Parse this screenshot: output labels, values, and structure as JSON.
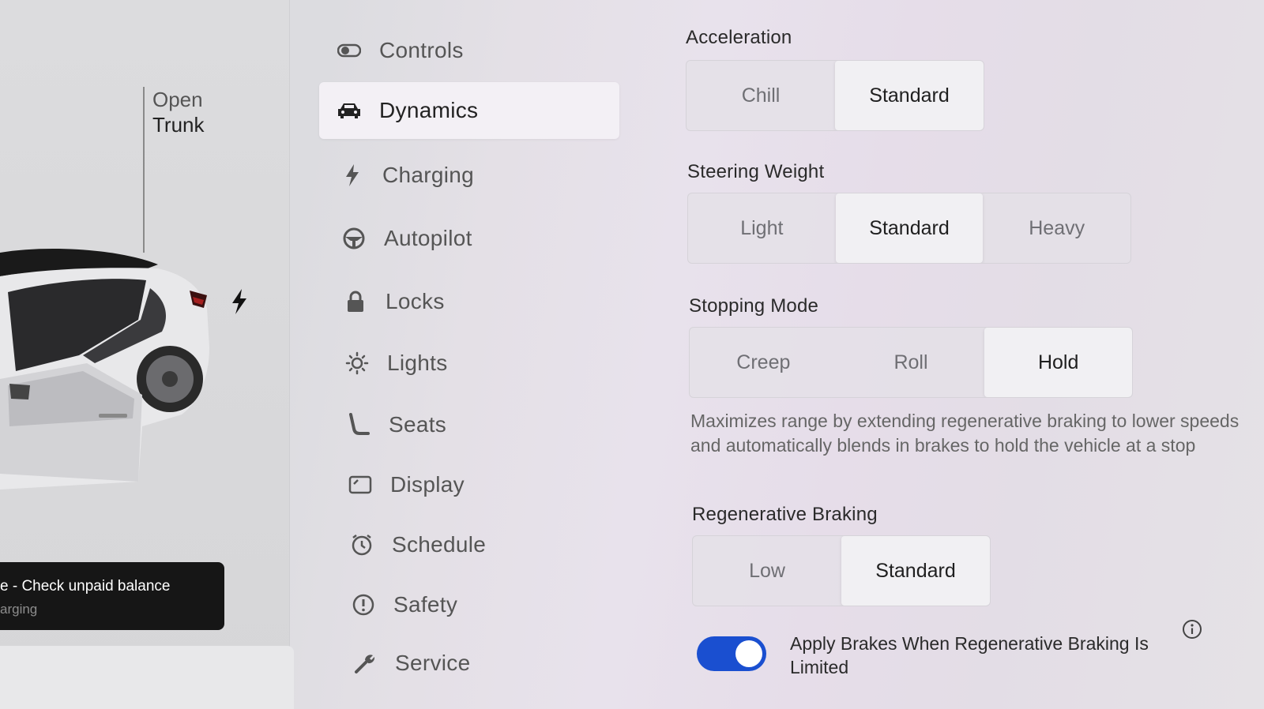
{
  "car_panel": {
    "trunk_line1": "Open",
    "trunk_line2": "Trunk",
    "toast_title": "e - Check unpaid balance",
    "toast_subtitle": "arging"
  },
  "nav": {
    "items": [
      {
        "label": "Controls",
        "icon": "toggle-icon"
      },
      {
        "label": "Dynamics",
        "icon": "car-icon",
        "active": true
      },
      {
        "label": "Charging",
        "icon": "bolt-icon"
      },
      {
        "label": "Autopilot",
        "icon": "steering-wheel-icon"
      },
      {
        "label": "Locks",
        "icon": "lock-icon"
      },
      {
        "label": "Lights",
        "icon": "sun-icon"
      },
      {
        "label": "Seats",
        "icon": "seat-icon"
      },
      {
        "label": "Display",
        "icon": "display-icon"
      },
      {
        "label": "Schedule",
        "icon": "alarm-clock-icon"
      },
      {
        "label": "Safety",
        "icon": "alert-circle-icon"
      },
      {
        "label": "Service",
        "icon": "wrench-icon"
      }
    ]
  },
  "dynamics": {
    "acceleration": {
      "title": "Acceleration",
      "options": [
        "Chill",
        "Standard"
      ],
      "selected": "Standard"
    },
    "steering": {
      "title": "Steering Weight",
      "options": [
        "Light",
        "Standard",
        "Heavy"
      ],
      "selected": "Standard"
    },
    "stopping": {
      "title": "Stopping Mode",
      "options": [
        "Creep",
        "Roll",
        "Hold"
      ],
      "selected": "Hold",
      "description": "Maximizes range by extending regenerative braking to lower speeds and automatically blends in brakes to hold the vehicle at a stop"
    },
    "regen": {
      "title": "Regenerative Braking",
      "options": [
        "Low",
        "Standard"
      ],
      "selected": "Standard"
    },
    "apply_brakes": {
      "label": "Apply Brakes When Regenerative Braking Is Limited",
      "enabled": true
    }
  },
  "colors": {
    "toggle_on": "#1a4fd0",
    "selected_bg": "#f1f0f3"
  }
}
